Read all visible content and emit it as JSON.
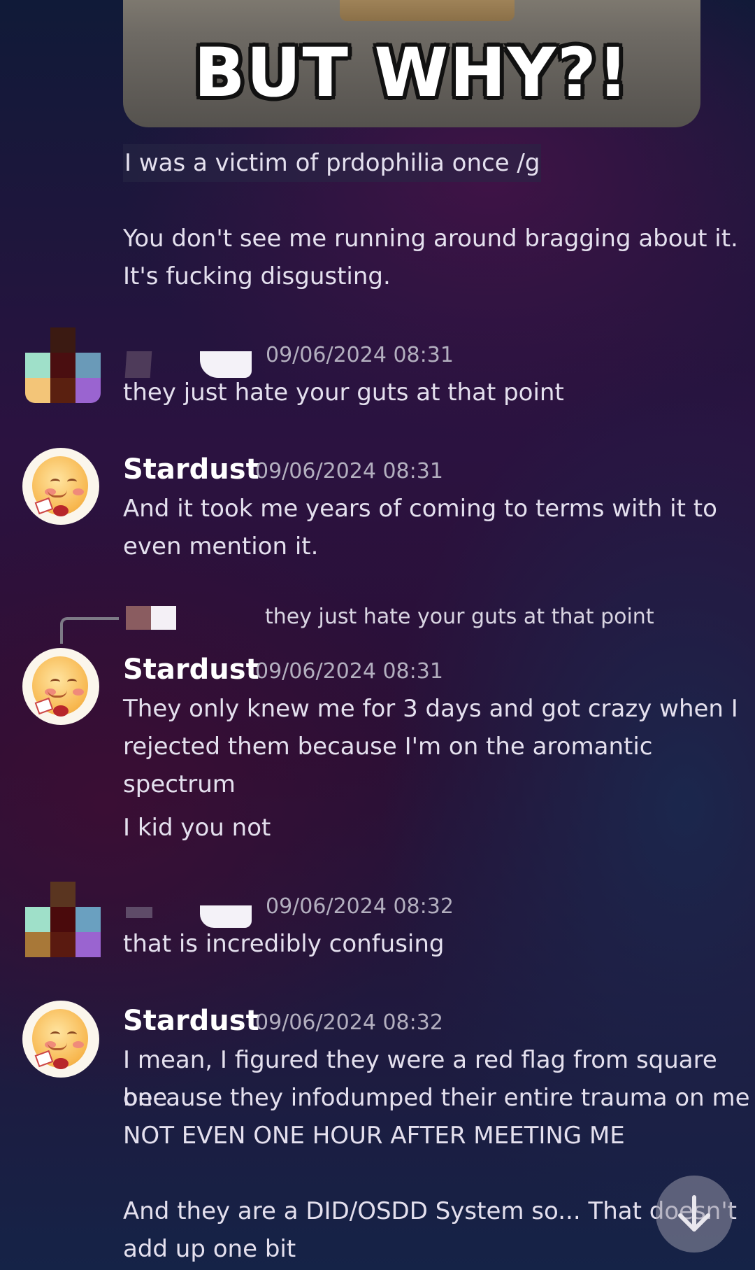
{
  "attachment": {
    "caption": "BUT WHY?!"
  },
  "messages_top": {
    "highlighted": "I was a victim of prdophilia once /g",
    "line2": "You don't see me running around bragging about it.",
    "line3": "It's fucking disgusting."
  },
  "msg1": {
    "timestamp": "09/06/2024 08:31",
    "text": "they just hate your guts at that point"
  },
  "msg2": {
    "author": "Stardust",
    "timestamp": "09/06/2024 08:31",
    "line1": "And it took me years of coming to terms with it to",
    "line2": "even mention it."
  },
  "reply": {
    "quoted": "they just hate your guts at that point"
  },
  "msg3": {
    "author": "Stardust",
    "timestamp": "09/06/2024 08:31",
    "line1": "They only knew me for 3 days and got crazy when I",
    "line2": "rejected them because I'm on the aromantic",
    "line3": "spectrum",
    "line4": "I kid you not"
  },
  "msg4": {
    "timestamp": "09/06/2024 08:32",
    "text": "that is incredibly confusing"
  },
  "msg5": {
    "author": "Stardust",
    "timestamp": "09/06/2024 08:32",
    "line1": "I mean, I figured they were a red flag from square one",
    "line2": "because they infodumped their entire trauma on me",
    "line3": "NOT EVEN ONE HOUR AFTER MEETING ME",
    "line4": "And they are a DID/OSDD System so... That doesn't",
    "line5": "add up one bit"
  },
  "icons": {
    "scroll": "arrow-down-icon"
  }
}
